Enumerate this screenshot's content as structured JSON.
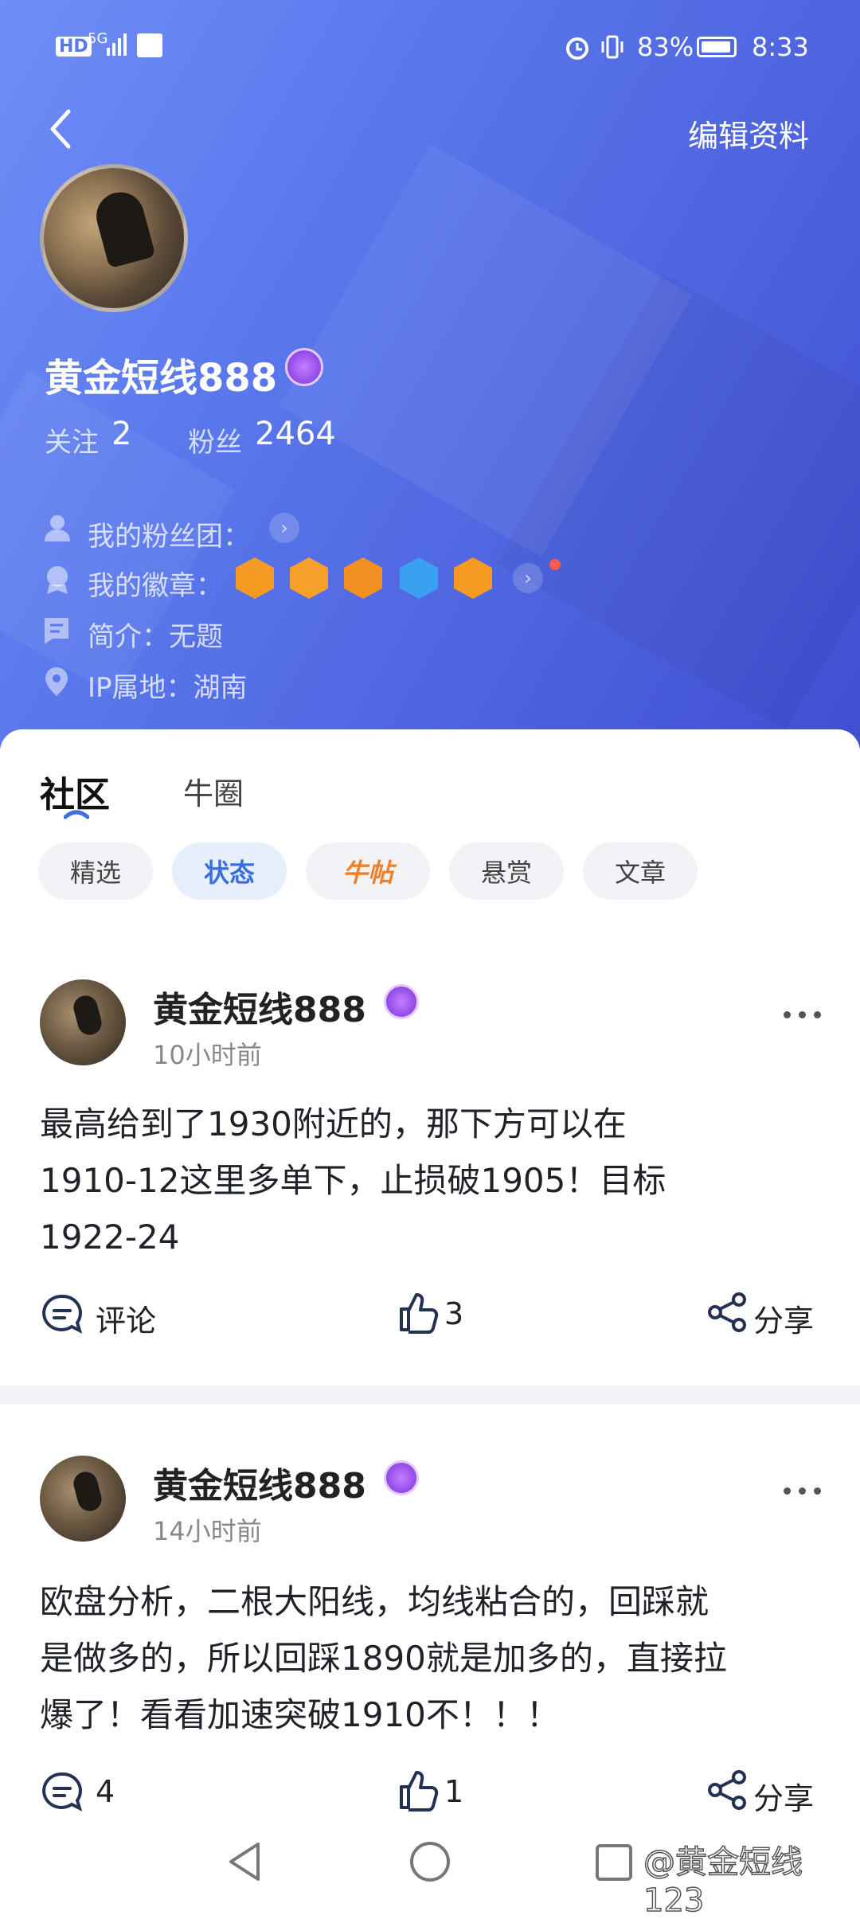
{
  "status_bar": {
    "hd": "HD",
    "net": "5G",
    "battery": "83%",
    "time": "8:33"
  },
  "header": {
    "edit_label": "编辑资料"
  },
  "profile": {
    "name": "黄金短线888",
    "follow_label": "关注",
    "follow_count": "2",
    "fans_label": "粉丝",
    "fans_count": "2464",
    "fan_group_label": "我的粉丝团：",
    "badges_label": "我的徽章：",
    "intro": "简介：无题",
    "ip": "IP属地：湖南"
  },
  "tabs": [
    {
      "label": "社区"
    },
    {
      "label": "牛圈"
    }
  ],
  "filters": [
    {
      "label": "精选"
    },
    {
      "label": "状态"
    },
    {
      "label": "牛帖"
    },
    {
      "label": "悬赏"
    },
    {
      "label": "文章"
    }
  ],
  "posts": [
    {
      "author": "黄金短线888",
      "time": "10小时前",
      "lines": [
        "最高给到了1930附近的，那下方可以在",
        "1910-12这里多单下，止损破1905！目标",
        "1922-24"
      ],
      "comment": "评论",
      "likes": "3",
      "share": "分享"
    },
    {
      "author": "黄金短线888",
      "time": "14小时前",
      "lines": [
        "欧盘分析，二根大阳线，均线粘合的，回踩就",
        "是做多的，所以回踩1890就是加多的，直接拉",
        "爆了！看看加速突破1910不！！！"
      ],
      "comment": "4",
      "likes": "1",
      "share": "分享"
    }
  ],
  "watermark": "@黄金短线123",
  "colors": {
    "accent": "#3b6fe0",
    "hero": "#5a78ec",
    "badge_orange": "#f59a23"
  }
}
